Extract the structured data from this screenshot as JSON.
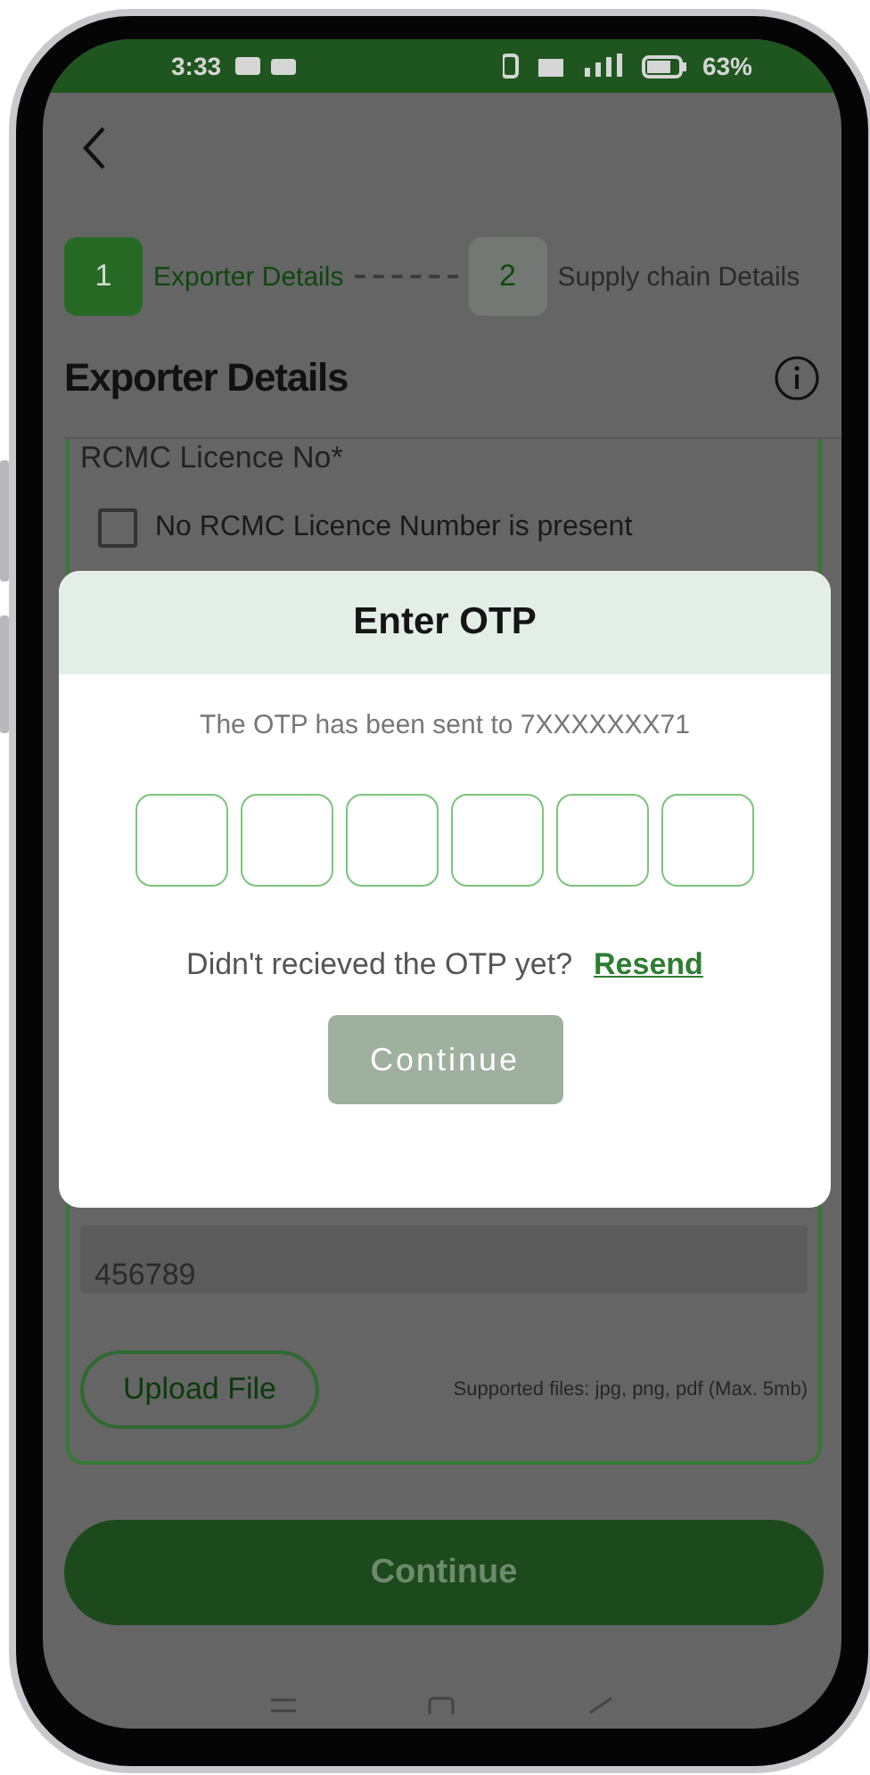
{
  "status_bar": {
    "time": "3:33",
    "battery": "63%"
  },
  "stepper": [
    {
      "number": "1",
      "label": "Exporter Details",
      "selected": true
    },
    {
      "number": "2",
      "label": "Supply chain Details",
      "selected": false
    }
  ],
  "title": "Exporter Details",
  "form": {
    "field_label": "RCMC Licence No*",
    "checkbox": {
      "label": "No RCMC Licence Number is present",
      "checked": false
    },
    "field_value": "456789",
    "upload_button": "Upload File",
    "upload_hint": "Supported files: jpg, png, pdf (Max. 5mb)"
  },
  "continue_button": "Continue",
  "modal": {
    "title": "Enter OTP",
    "message": "The OTP has been sent to 7XXXXXXX71",
    "otp_boxes": [
      {
        "filled": false
      },
      {
        "filled": false
      },
      {
        "filled": false
      },
      {
        "filled": false
      },
      {
        "filled": false
      },
      {
        "filled": false
      }
    ],
    "resend_prompt": "Didn't recieved the OTP yet?",
    "resend_link": "Resend",
    "button": {
      "label": "Continue",
      "disabled": true
    }
  }
}
